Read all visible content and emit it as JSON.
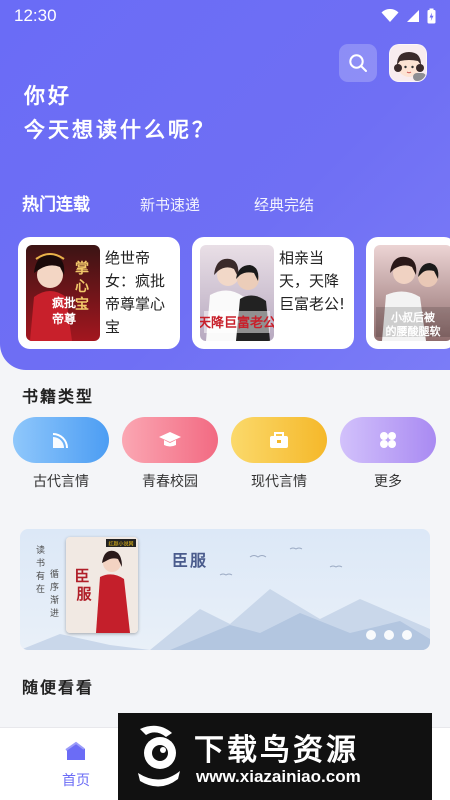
{
  "status_bar": {
    "time": "12:30"
  },
  "header": {
    "greeting": "你好",
    "question": "今天想读什么呢？"
  },
  "tabs": [
    {
      "label": "热门连载",
      "active": true
    },
    {
      "label": "新书速递",
      "active": false
    },
    {
      "label": "经典完结",
      "active": false
    }
  ],
  "books": [
    {
      "title": "绝世帝女：疯批帝尊掌心宝",
      "cover_text": "疯批帝尊掌心宝"
    },
    {
      "title": "相亲当天，天降巨富老公!",
      "cover_text": "天降巨富老公"
    },
    {
      "title": "",
      "cover_text": "小叔后被的腰酸腿软"
    }
  ],
  "categories_section": {
    "title": "书籍类型"
  },
  "categories": [
    {
      "label": "古代言情",
      "icon": "fan-icon",
      "color": "#5aa7f5"
    },
    {
      "label": "青春校园",
      "icon": "graduation-cap-icon",
      "color": "#f47a8e"
    },
    {
      "label": "现代言情",
      "icon": "briefcase-icon",
      "color": "#f7c640"
    },
    {
      "label": "更多",
      "icon": "grid-icon",
      "color": "#b89cf4"
    }
  ],
  "banner": {
    "title": "臣服",
    "vertical_left": "读书有在",
    "vertical_right": "循序渐进",
    "cover_text": "臣服",
    "cover_badge": "红颜小说网"
  },
  "random_section": {
    "title": "随便看看"
  },
  "bottom_nav": {
    "home_label": "首页"
  },
  "watermark": {
    "text": "下载鸟资源",
    "url": "www.xiazainiao.com"
  },
  "colors": {
    "accent": "#6b6cf6",
    "hero_bg": "#6c6df5"
  }
}
